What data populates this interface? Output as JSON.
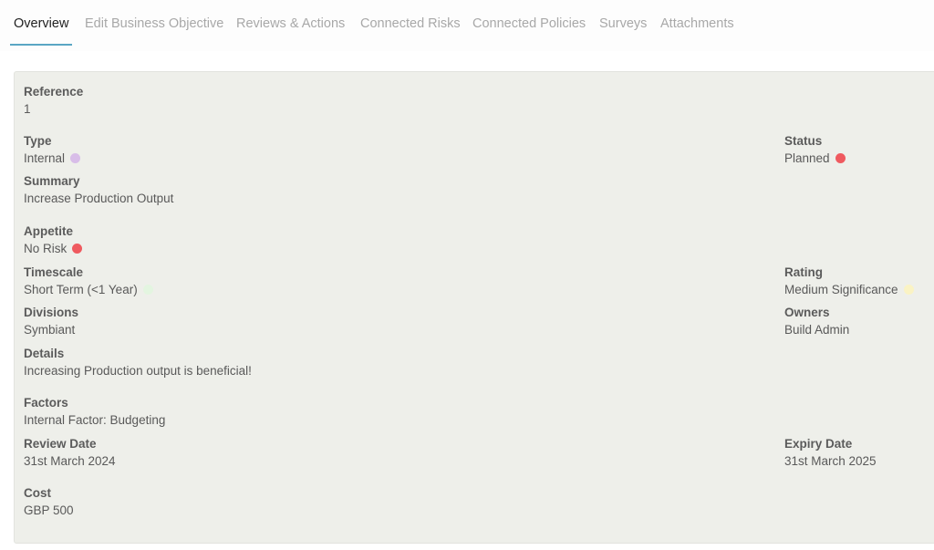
{
  "tabs": [
    {
      "label": "Overview",
      "active": true
    },
    {
      "label": "Edit Business Objective",
      "active": false
    },
    {
      "label": "Reviews & Actions",
      "active": false
    },
    {
      "label": "Connected Risks",
      "active": false
    },
    {
      "label": "Connected Policies",
      "active": false
    },
    {
      "label": "Surveys",
      "active": false
    },
    {
      "label": "Attachments",
      "active": false
    }
  ],
  "overview": {
    "reference": {
      "label": "Reference",
      "value": "1"
    },
    "type": {
      "label": "Type",
      "value": "Internal",
      "dot_color": "#d8bde8"
    },
    "status": {
      "label": "Status",
      "value": "Planned",
      "dot_color": "#ef5a5f"
    },
    "summary": {
      "label": "Summary",
      "value": "Increase Production Output"
    },
    "appetite": {
      "label": "Appetite",
      "value": "No Risk",
      "dot_color": "#ef5a5f"
    },
    "timescale": {
      "label": "Timescale",
      "value": "Short Term (<1 Year)",
      "dot_color": "#e3f5e0"
    },
    "rating": {
      "label": "Rating",
      "value": "Medium Significance",
      "dot_color": "#faf3c4"
    },
    "divisions": {
      "label": "Divisions",
      "value": "Symbiant"
    },
    "owners": {
      "label": "Owners",
      "value": "Build Admin"
    },
    "details": {
      "label": "Details",
      "value": "Increasing Production output is beneficial!"
    },
    "factors": {
      "label": "Factors",
      "value": "Internal Factor: Budgeting"
    },
    "review_date": {
      "label": "Review Date",
      "value": "31st March 2024"
    },
    "expiry_date": {
      "label": "Expiry Date",
      "value": "31st March 2025"
    },
    "cost": {
      "label": "Cost",
      "value": "GBP 500"
    }
  }
}
